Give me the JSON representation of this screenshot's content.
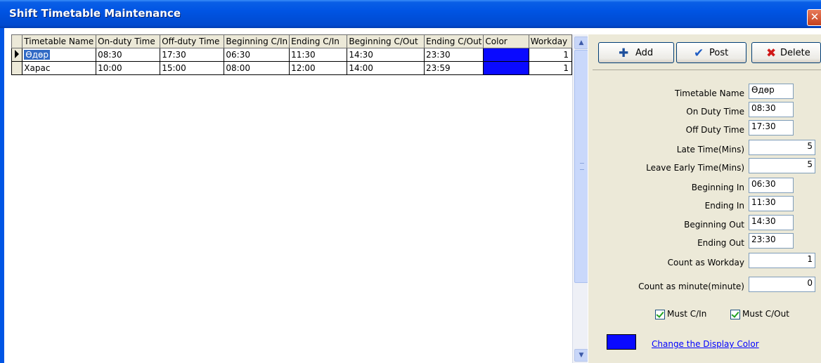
{
  "window": {
    "title": "Shift Timetable Maintenance"
  },
  "toolbar": {
    "add_label": "Add",
    "post_label": "Post",
    "delete_label": "Delete"
  },
  "grid": {
    "headers": [
      "Timetable Name",
      "On-duty Time",
      "Off-duty Time",
      "Beginning C/In",
      "Ending C/In",
      "Beginning C/Out",
      "Ending C/Out",
      "Color",
      "Workday"
    ],
    "rows": [
      {
        "name": "Өдөр",
        "on": "08:30",
        "off": "17:30",
        "bci": "06:30",
        "eci": "11:30",
        "bco": "14:30",
        "eco": "23:30",
        "color": "#0a0aff",
        "workday": "1"
      },
      {
        "name": "Харас",
        "on": "10:00",
        "off": "15:00",
        "bci": "08:00",
        "eci": "12:00",
        "bco": "14:00",
        "eco": "23:59",
        "color": "#0a0aff",
        "workday": "1"
      }
    ]
  },
  "form": {
    "timetable_name": {
      "label": "Timetable Name",
      "value": "Өдөр"
    },
    "on_duty": {
      "label": "On Duty Time",
      "value": "08:30"
    },
    "off_duty": {
      "label": "Off Duty Time",
      "value": "17:30"
    },
    "late_time": {
      "label": "Late Time(Mins)",
      "value": "5"
    },
    "leave_early": {
      "label": "Leave Early Time(Mins)",
      "value": "5"
    },
    "beginning_in": {
      "label": "Beginning In",
      "value": "06:30"
    },
    "ending_in": {
      "label": "Ending In",
      "value": "11:30"
    },
    "beginning_out": {
      "label": "Beginning Out",
      "value": "14:30"
    },
    "ending_out": {
      "label": "Ending Out",
      "value": "23:30"
    },
    "count_workday": {
      "label": "Count as Workday",
      "value": "1"
    },
    "count_minute": {
      "label": "Count as minute(minute)",
      "value": "0"
    },
    "must_cin": {
      "label": "Must C/In",
      "checked": true
    },
    "must_cout": {
      "label": "Must C/Out",
      "checked": true
    },
    "display_color": "#0a0aff",
    "change_color_link": "Change the Display Color"
  },
  "icons": {
    "add": "plus-icon",
    "post": "checkmark-icon",
    "delete": "x-icon",
    "close": "close-icon"
  }
}
